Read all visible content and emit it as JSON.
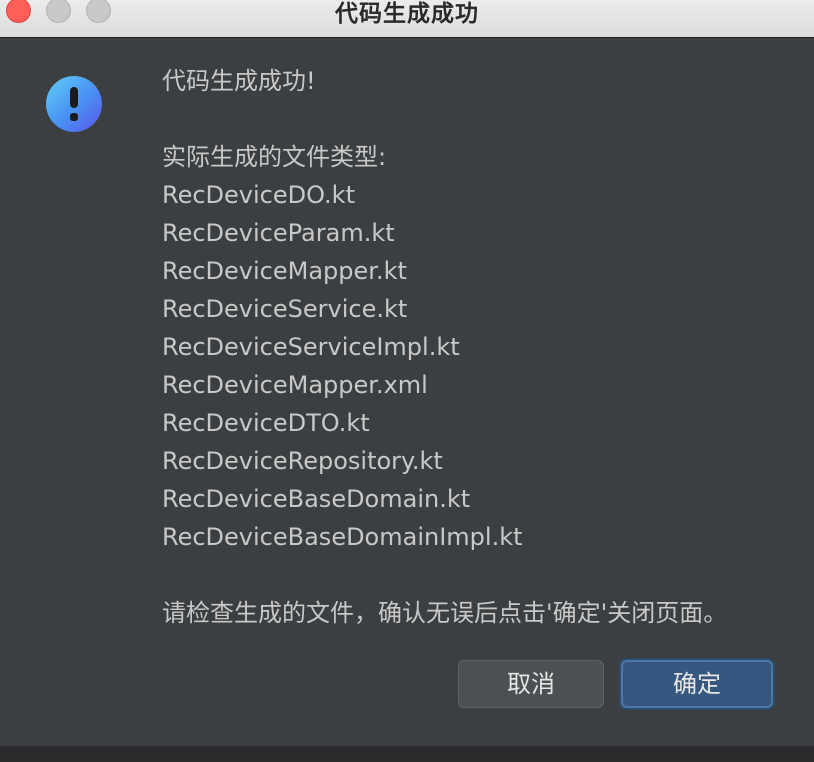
{
  "window": {
    "title": "代码生成成功"
  },
  "icons": {
    "alert": "exclamation-icon",
    "accent_gradient": [
      "#5fd1f3",
      "#4a8ff5",
      "#5b57e6"
    ]
  },
  "message": {
    "heading": "代码生成成功!",
    "types_label": "实际生成的文件类型:",
    "files": [
      "RecDeviceDO.kt",
      "RecDeviceParam.kt",
      "RecDeviceMapper.kt",
      "RecDeviceService.kt",
      "RecDeviceServiceImpl.kt",
      "RecDeviceMapper.xml",
      "RecDeviceDTO.kt",
      "RecDeviceRepository.kt",
      "RecDeviceBaseDomain.kt",
      "RecDeviceBaseDomainImpl.kt"
    ],
    "footer": "请检查生成的文件，确认无误后点击'确定'关闭页面。"
  },
  "buttons": {
    "cancel": "取消",
    "ok": "确定"
  },
  "colors": {
    "dialog_bg": "#3c3f41",
    "text": "#c8c8c8",
    "primary_button": "#365880",
    "secondary_button": "#4c5052"
  }
}
